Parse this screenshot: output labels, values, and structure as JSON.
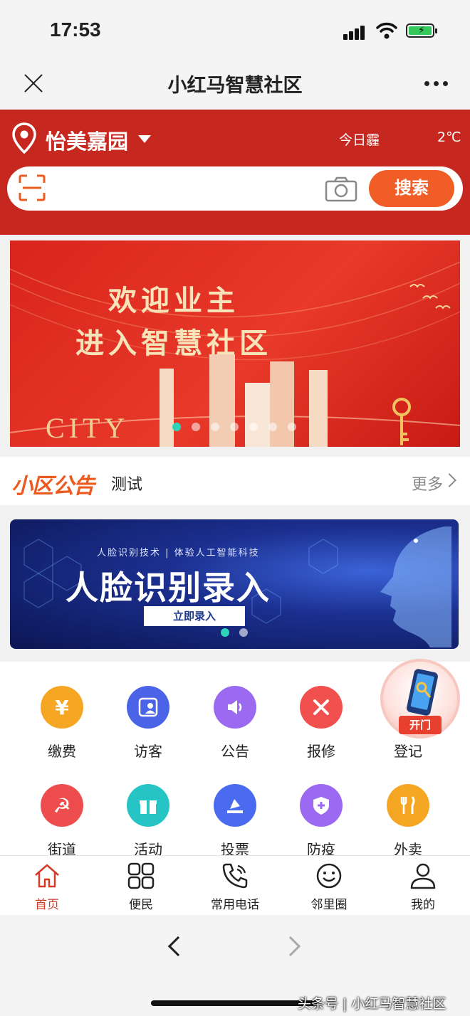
{
  "status_bar": {
    "time": "17:53"
  },
  "title_bar": {
    "title": "小红马智慧社区"
  },
  "header": {
    "community": "怡美嘉园",
    "weather": "今日霾",
    "temperature": "2℃",
    "search_button": "搜索"
  },
  "banner": {
    "line1": "欢迎业主",
    "line2": "进入智慧社区",
    "city": "CITY",
    "slide_count": 7,
    "active_slide": 0
  },
  "notice": {
    "title": "小区公告",
    "text": "测试",
    "more": "更多"
  },
  "face_banner": {
    "subtitle": "人脸识别技术 | 体验人工智能科技",
    "title": "人脸识别录入",
    "button": "立即录入"
  },
  "services": [
    {
      "label": "缴费",
      "icon": "payment-icon",
      "color": "#f5a623"
    },
    {
      "label": "访客",
      "icon": "visitor-icon",
      "color": "#4a63e7"
    },
    {
      "label": "公告",
      "icon": "announcement-icon",
      "color": "#9b6af0"
    },
    {
      "label": "报修",
      "icon": "repair-icon",
      "color": "#f2504f"
    },
    {
      "label": "登记",
      "icon": "register-icon",
      "color": "#f2504f"
    },
    {
      "label": "街道",
      "icon": "street-icon",
      "color": "#ee4d4d"
    },
    {
      "label": "活动",
      "icon": "gift-icon",
      "color": "#26c4c4"
    },
    {
      "label": "投票",
      "icon": "vote-icon",
      "color": "#4a6bf0"
    },
    {
      "label": "防疫",
      "icon": "shield-plus-icon",
      "color": "#9b6af0"
    },
    {
      "label": "外卖",
      "icon": "fork-knife-icon",
      "color": "#f5a623"
    }
  ],
  "open_door": {
    "label": "开门"
  },
  "tabs": [
    {
      "label": "首页",
      "icon": "home-icon"
    },
    {
      "label": "便民",
      "icon": "grid-icon"
    },
    {
      "label": "常用电话",
      "icon": "phone-icon"
    },
    {
      "label": "邻里圈",
      "icon": "smile-icon"
    },
    {
      "label": "我的",
      "icon": "user-icon"
    }
  ],
  "watermark": "头条号 | 小红马智慧社区",
  "colors": {
    "brand_red": "#c6271e",
    "search_orange": "#f05d27",
    "notice_orange": "#ec5a1f"
  }
}
